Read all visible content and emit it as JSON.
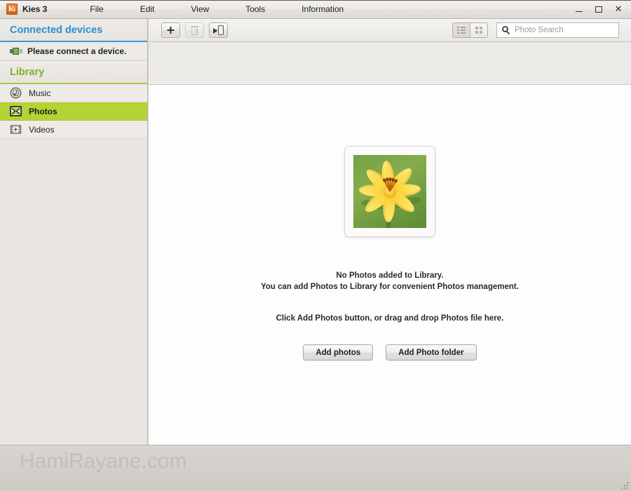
{
  "window": {
    "app_icon": "kies-app-icon",
    "title": "Kies 3",
    "controls": {
      "minimize": "minimize-button",
      "maximize": "maximize-button",
      "close": "close-button"
    }
  },
  "menubar": {
    "items": [
      {
        "label": "File"
      },
      {
        "label": "Edit"
      },
      {
        "label": "View"
      },
      {
        "label": "Tools"
      },
      {
        "label": "Information"
      }
    ]
  },
  "sidebar": {
    "connected_devices": {
      "header": "Connected devices",
      "header_color": "#2a8fd4",
      "accent_color": "#3a9ad9",
      "device_message": "Please connect a device.",
      "device_icon": "usb-connector-icon"
    },
    "library": {
      "header": "Library",
      "header_color": "#7fb02a",
      "accent_color": "#a8cc3a",
      "selected_color": "#b5d334",
      "items": [
        {
          "label": "Music",
          "icon": "music-disc-icon",
          "selected": false
        },
        {
          "label": "Photos",
          "icon": "photos-icon",
          "selected": true
        },
        {
          "label": "Videos",
          "icon": "film-strip-icon",
          "selected": false
        }
      ]
    }
  },
  "toolbar": {
    "add_button": "add-icon",
    "delete_button": "trash-icon",
    "send_to_device_button": "send-to-device-icon",
    "view_list": "list-view-icon",
    "view_grid": "grid-view-icon",
    "active_view": "grid",
    "search": {
      "placeholder": "Photo Search",
      "value": "",
      "icon": "search-icon"
    }
  },
  "content": {
    "thumbnail": {
      "name": "photo-placeholder-thumbnail",
      "description": "yellow lily flower on green background"
    },
    "empty_state": {
      "line1": "No Photos added to Library.",
      "line2": "You can add Photos to Library for convenient Photos management.",
      "line3": "Click Add Photos button, or drag and drop Photos file here."
    },
    "buttons": [
      {
        "label": "Add photos",
        "name": "add-photos-button"
      },
      {
        "label": "Add Photo folder",
        "name": "add-photo-folder-button"
      }
    ]
  },
  "footer": {
    "watermark": "HamiRayane.com",
    "resize_grip": "resize-grip-icon"
  }
}
